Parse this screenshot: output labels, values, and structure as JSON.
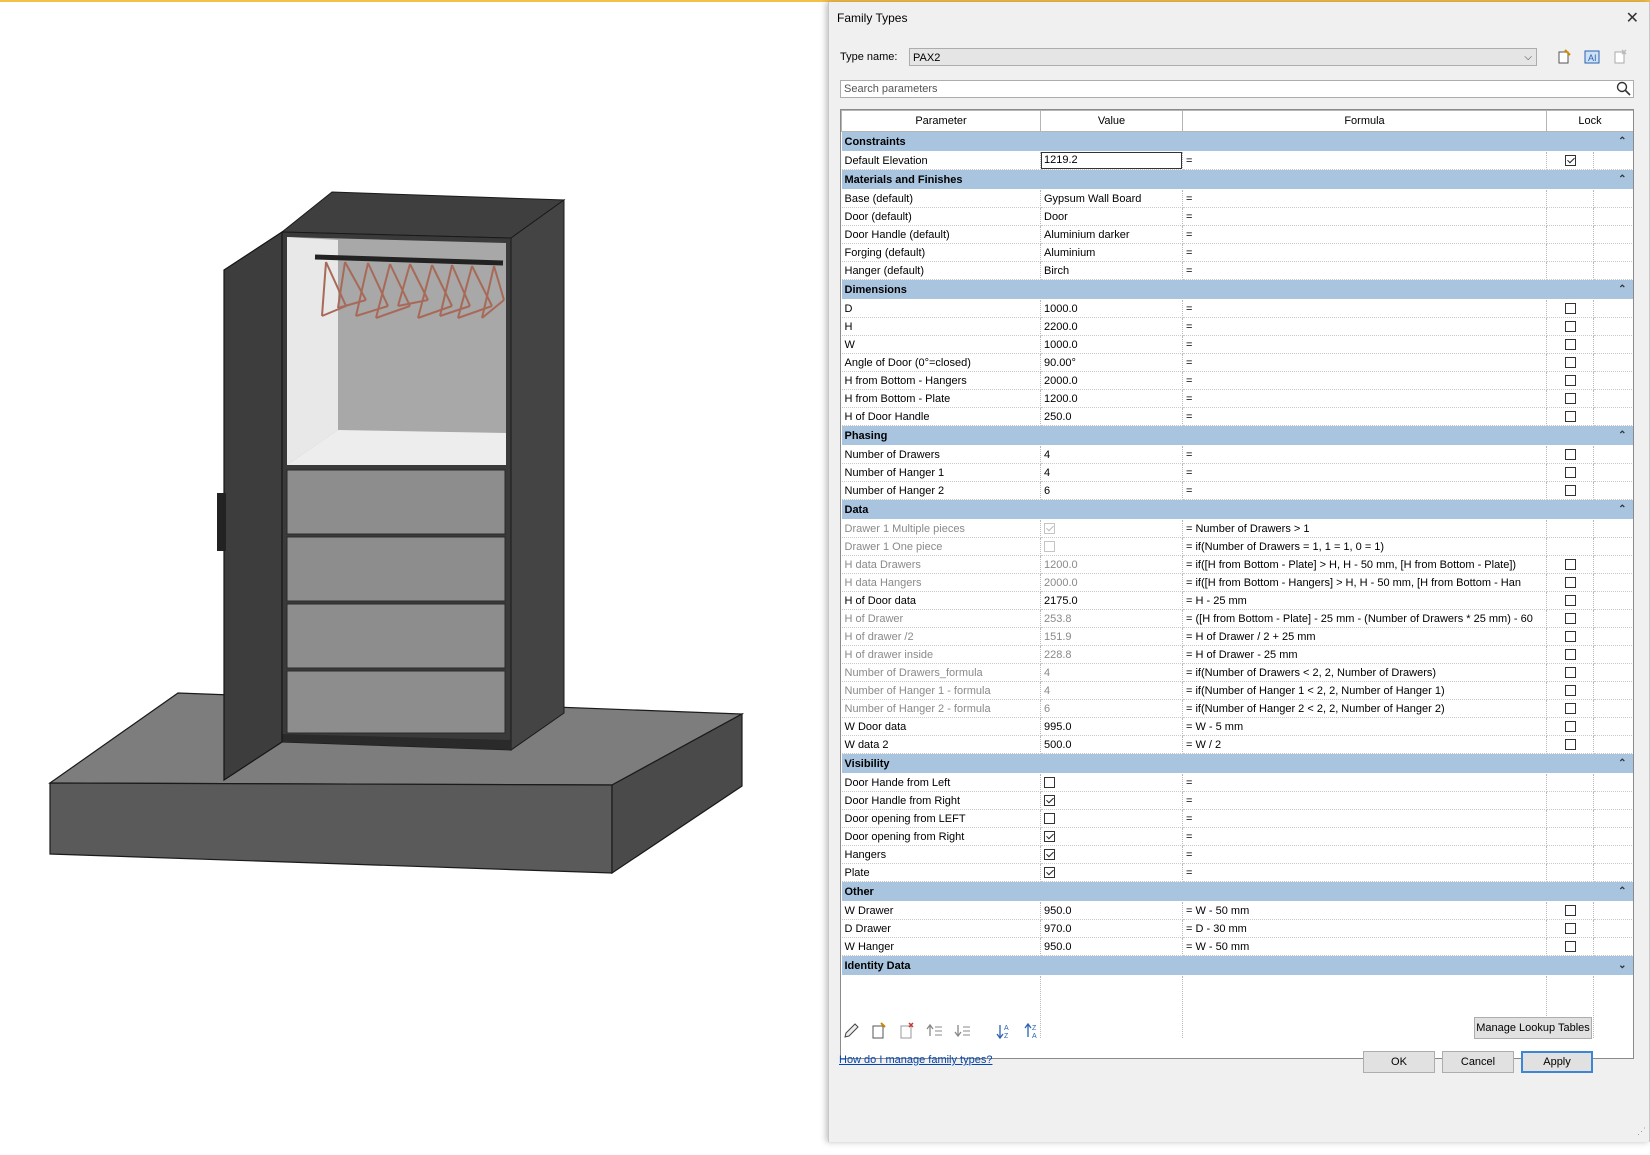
{
  "dialog": {
    "title": "Family Types",
    "type_name_label": "Type name:",
    "type_name_value": "PAX2",
    "search_placeholder": "Search parameters",
    "columns": [
      "Parameter",
      "Value",
      "Formula",
      "Lock"
    ]
  },
  "groups": [
    {
      "name": "Constraints",
      "rows": [
        {
          "param": "Default Elevation",
          "value": "1219.2",
          "formula": "=",
          "lock": "checked",
          "editing": true
        }
      ]
    },
    {
      "name": "Materials and Finishes",
      "rows": [
        {
          "param": "Base (default)",
          "value": "Gypsum Wall Board",
          "formula": "=",
          "lock": "none"
        },
        {
          "param": "Door (default)",
          "value": "Door",
          "formula": "=",
          "lock": "none"
        },
        {
          "param": "Door Handle (default)",
          "value": "Aluminium darker",
          "formula": "=",
          "lock": "none"
        },
        {
          "param": "Forging (default)",
          "value": "Aluminium",
          "formula": "=",
          "lock": "none"
        },
        {
          "param": "Hanger (default)",
          "value": "Birch",
          "formula": "=",
          "lock": "none"
        }
      ]
    },
    {
      "name": "Dimensions",
      "rows": [
        {
          "param": "D",
          "value": "1000.0",
          "formula": "=",
          "lock": "unchecked"
        },
        {
          "param": "H",
          "value": "2200.0",
          "formula": "=",
          "lock": "unchecked"
        },
        {
          "param": "W",
          "value": "1000.0",
          "formula": "=",
          "lock": "unchecked"
        },
        {
          "param": "Angle of Door (0°=closed)",
          "value": "90.00°",
          "formula": "=",
          "lock": "unchecked"
        },
        {
          "param": "H from Bottom - Hangers",
          "value": "2000.0",
          "formula": "=",
          "lock": "unchecked"
        },
        {
          "param": "H from Bottom - Plate",
          "value": "1200.0",
          "formula": "=",
          "lock": "unchecked"
        },
        {
          "param": "H of Door Handle",
          "value": "250.0",
          "formula": "=",
          "lock": "unchecked"
        }
      ]
    },
    {
      "name": "Phasing",
      "rows": [
        {
          "param": "Number of Drawers",
          "value": "4",
          "formula": "=",
          "lock": "unchecked"
        },
        {
          "param": "Number of Hanger 1",
          "value": "4",
          "formula": "=",
          "lock": "unchecked"
        },
        {
          "param": "Number of Hanger 2",
          "value": "6",
          "formula": "=",
          "lock": "unchecked"
        }
      ]
    },
    {
      "name": "Data",
      "rows": [
        {
          "param": "Drawer 1 Multiple pieces",
          "value": "",
          "value_check": "checked-dim",
          "formula": "= Number of Drawers > 1",
          "lock": "none",
          "gray": true
        },
        {
          "param": "Drawer 1 One piece",
          "value": "",
          "value_check": "unchecked-dim",
          "formula": "= if(Number of Drawers = 1, 1 = 1, 0 = 1)",
          "lock": "none",
          "gray": true
        },
        {
          "param": "H data Drawers",
          "value": "1200.0",
          "formula": "= if([H from Bottom - Plate] > H, H - 50 mm, [H from Bottom - Plate])",
          "lock": "unchecked",
          "gray": true
        },
        {
          "param": "H data Hangers",
          "value": "2000.0",
          "formula": "= if([H from Bottom - Hangers] > H, H - 50 mm, [H from Bottom - Han",
          "lock": "unchecked",
          "gray": true
        },
        {
          "param": "H of Door data",
          "value": "2175.0",
          "formula": "= H - 25 mm",
          "lock": "unchecked"
        },
        {
          "param": "H of Drawer",
          "value": "253.8",
          "formula": "= ([H from Bottom - Plate] - 25 mm - (Number of Drawers * 25 mm) - 60",
          "lock": "unchecked",
          "gray": true
        },
        {
          "param": "H of drawer /2",
          "value": "151.9",
          "formula": "= H of Drawer / 2 + 25 mm",
          "lock": "unchecked",
          "gray": true
        },
        {
          "param": "H of drawer inside",
          "value": "228.8",
          "formula": "= H of Drawer - 25 mm",
          "lock": "unchecked",
          "gray": true
        },
        {
          "param": "Number of Drawers_formula",
          "value": "4",
          "formula": "= if(Number of Drawers < 2, 2, Number of Drawers)",
          "lock": "unchecked",
          "gray": true
        },
        {
          "param": "Number of Hanger 1 - formula",
          "value": "4",
          "formula": "= if(Number of Hanger 1 < 2, 2, Number of Hanger 1)",
          "lock": "unchecked",
          "gray": true
        },
        {
          "param": "Number of Hanger 2 - formula",
          "value": "6",
          "formula": "= if(Number of Hanger 2 < 2, 2, Number of Hanger 2)",
          "lock": "unchecked",
          "gray": true
        },
        {
          "param": "W Door data",
          "value": "995.0",
          "formula": "= W - 5 mm",
          "lock": "unchecked"
        },
        {
          "param": "W data 2",
          "value": "500.0",
          "formula": "= W / 2",
          "lock": "unchecked"
        }
      ]
    },
    {
      "name": "Visibility",
      "rows": [
        {
          "param": "Door Hande from Left",
          "value": "",
          "value_check": "unchecked",
          "formula": "=",
          "lock": "none"
        },
        {
          "param": "Door Handle from Right",
          "value": "",
          "value_check": "checked",
          "formula": "=",
          "lock": "none"
        },
        {
          "param": "Door opening from LEFT",
          "value": "",
          "value_check": "unchecked",
          "formula": "=",
          "lock": "none"
        },
        {
          "param": "Door opening from Right",
          "value": "",
          "value_check": "checked",
          "formula": "=",
          "lock": "none"
        },
        {
          "param": "Hangers",
          "value": "",
          "value_check": "checked",
          "formula": "=",
          "lock": "none"
        },
        {
          "param": "Plate",
          "value": "",
          "value_check": "checked",
          "formula": "=",
          "lock": "none"
        }
      ]
    },
    {
      "name": "Other",
      "rows": [
        {
          "param": "W Drawer",
          "value": "950.0",
          "formula": "= W - 50 mm",
          "lock": "unchecked"
        },
        {
          "param": "D Drawer",
          "value": "970.0",
          "formula": "= D - 30 mm",
          "lock": "unchecked"
        },
        {
          "param": "W Hanger",
          "value": "950.0",
          "formula": "= W - 50 mm",
          "lock": "unchecked"
        }
      ]
    },
    {
      "name": "Identity Data",
      "rows": [],
      "collapsed": true
    }
  ],
  "buttons": {
    "manage_lookup": "Manage Lookup Tables",
    "help": "How do I manage family types?",
    "ok": "OK",
    "cancel": "Cancel",
    "apply": "Apply"
  }
}
